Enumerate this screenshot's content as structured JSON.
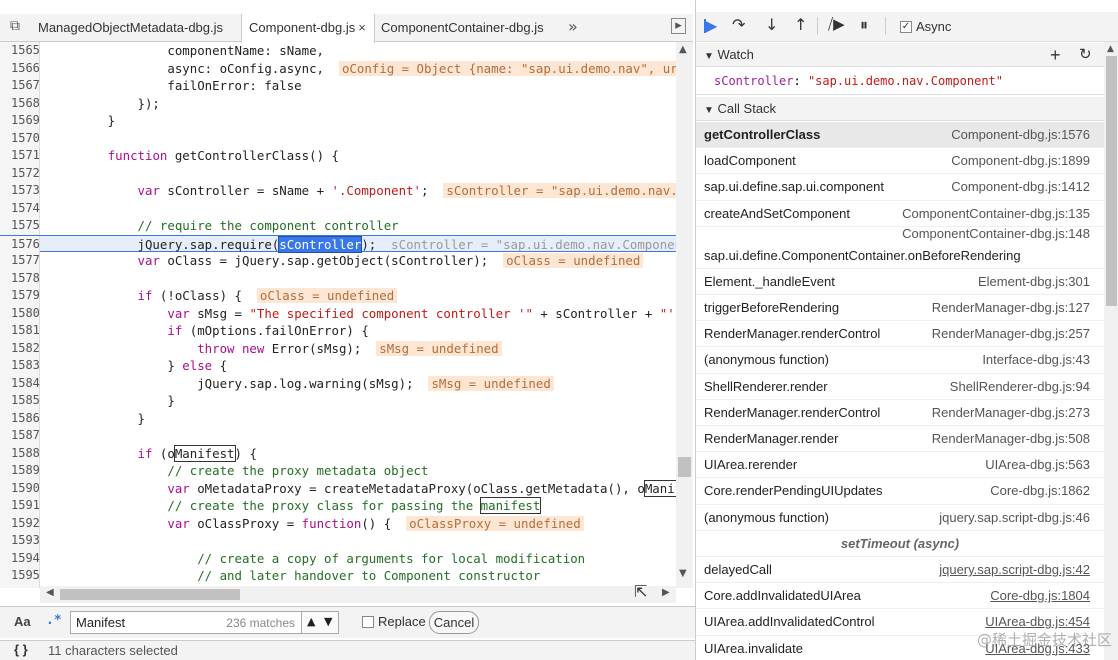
{
  "tabs": [
    {
      "label": "ManagedObjectMetadata-dbg.js",
      "active": false
    },
    {
      "label": "Component-dbg.js",
      "active": true
    },
    {
      "label": "ComponentContainer-dbg.js",
      "active": false
    }
  ],
  "code": {
    "lines": [
      {
        "n": "1565",
        "parts": [
          {
            "t": "                componentName: sName,"
          }
        ]
      },
      {
        "n": "1566",
        "parts": [
          {
            "t": "                async: oConfig.async,  "
          },
          {
            "t": "oConfig = Object {name: \"sap.ui.demo.nav\", url: \"\",",
            "c": "hv"
          }
        ]
      },
      {
        "n": "1567",
        "parts": [
          {
            "t": "                failOnError: false"
          }
        ]
      },
      {
        "n": "1568",
        "parts": [
          {
            "t": "            });"
          }
        ]
      },
      {
        "n": "1569",
        "parts": [
          {
            "t": "        }"
          }
        ]
      },
      {
        "n": "1570",
        "parts": [
          {
            "t": ""
          }
        ]
      },
      {
        "n": "1571",
        "parts": [
          {
            "t": "        "
          },
          {
            "t": "function",
            "c": "kw"
          },
          {
            "t": " getControllerClass() {"
          }
        ]
      },
      {
        "n": "1572",
        "parts": [
          {
            "t": ""
          }
        ]
      },
      {
        "n": "1573",
        "parts": [
          {
            "t": "            "
          },
          {
            "t": "var",
            "c": "kw"
          },
          {
            "t": " sController = sName + "
          },
          {
            "t": "'.Component'",
            "c": "str"
          },
          {
            "t": ";  "
          },
          {
            "t": "sController = \"sap.ui.demo.nav.Compon",
            "c": "hv"
          }
        ]
      },
      {
        "n": "1574",
        "parts": [
          {
            "t": ""
          }
        ]
      },
      {
        "n": "1575",
        "parts": [
          {
            "t": "            "
          },
          {
            "t": "// require the component controller",
            "c": "cm"
          }
        ]
      },
      {
        "n": "1576",
        "hl": true,
        "parts": [
          {
            "t": "            jQuery.sap.require("
          },
          {
            "t": "sController",
            "c": "sel"
          },
          {
            "t": ");  "
          },
          {
            "t": "sController = \"sap.ui.demo.nav.Component\"",
            "c": "hv2"
          }
        ]
      },
      {
        "n": "1577",
        "parts": [
          {
            "t": "            "
          },
          {
            "t": "var",
            "c": "kw"
          },
          {
            "t": " oClass = jQuery.sap.getObject(sController);  "
          },
          {
            "t": "oClass = undefined",
            "c": "hv"
          }
        ]
      },
      {
        "n": "1578",
        "parts": [
          {
            "t": ""
          }
        ]
      },
      {
        "n": "1579",
        "parts": [
          {
            "t": "            "
          },
          {
            "t": "if",
            "c": "kw"
          },
          {
            "t": " (!oClass) {  "
          },
          {
            "t": "oClass = undefined",
            "c": "hv"
          }
        ]
      },
      {
        "n": "1580",
        "parts": [
          {
            "t": "                "
          },
          {
            "t": "var",
            "c": "kw"
          },
          {
            "t": " sMsg = "
          },
          {
            "t": "\"The specified component controller '\"",
            "c": "str"
          },
          {
            "t": " + sController + "
          },
          {
            "t": "\"' could",
            "c": "str"
          }
        ]
      },
      {
        "n": "1581",
        "parts": [
          {
            "t": "                "
          },
          {
            "t": "if",
            "c": "kw"
          },
          {
            "t": " (mOptions.failOnError) {"
          }
        ]
      },
      {
        "n": "1582",
        "parts": [
          {
            "t": "                    "
          },
          {
            "t": "throw new",
            "c": "kw"
          },
          {
            "t": " Error(sMsg);  "
          },
          {
            "t": "sMsg = undefined",
            "c": "hv"
          }
        ]
      },
      {
        "n": "1583",
        "parts": [
          {
            "t": "                } "
          },
          {
            "t": "else",
            "c": "kw"
          },
          {
            "t": " {"
          }
        ]
      },
      {
        "n": "1584",
        "parts": [
          {
            "t": "                    jQuery.sap.log.warning(sMsg);  "
          },
          {
            "t": "sMsg = undefined",
            "c": "hv"
          }
        ]
      },
      {
        "n": "1585",
        "parts": [
          {
            "t": "                }"
          }
        ]
      },
      {
        "n": "1586",
        "parts": [
          {
            "t": "            }"
          }
        ]
      },
      {
        "n": "1587",
        "parts": [
          {
            "t": ""
          }
        ]
      },
      {
        "n": "1588",
        "parts": [
          {
            "t": "            "
          },
          {
            "t": "if",
            "c": "kw"
          },
          {
            "t": " (o"
          },
          {
            "t": "Manifest",
            "c": "box"
          },
          {
            "t": ") {"
          }
        ]
      },
      {
        "n": "1589",
        "parts": [
          {
            "t": "                "
          },
          {
            "t": "// create the proxy metadata object",
            "c": "cm"
          }
        ]
      },
      {
        "n": "1590",
        "parts": [
          {
            "t": "                "
          },
          {
            "t": "var",
            "c": "kw"
          },
          {
            "t": " oMetadataProxy = createMetadataProxy(oClass.getMetadata(), o"
          },
          {
            "t": "Manifest",
            "c": "box"
          },
          {
            "t": ");"
          }
        ]
      },
      {
        "n": "1591",
        "parts": [
          {
            "t": "                "
          },
          {
            "t": "// create the proxy class for passing the ",
            "c": "cm"
          },
          {
            "t": "manifest",
            "c": "box cm"
          }
        ]
      },
      {
        "n": "1592",
        "parts": [
          {
            "t": "                "
          },
          {
            "t": "var",
            "c": "kw"
          },
          {
            "t": " oClassProxy = "
          },
          {
            "t": "function",
            "c": "kw"
          },
          {
            "t": "() {  "
          },
          {
            "t": "oClassProxy = undefined",
            "c": "hv"
          }
        ]
      },
      {
        "n": "1593",
        "parts": [
          {
            "t": ""
          }
        ]
      },
      {
        "n": "1594",
        "parts": [
          {
            "t": "                    "
          },
          {
            "t": "// create a copy of arguments for local modification",
            "c": "cm"
          }
        ]
      },
      {
        "n": "1595",
        "parts": [
          {
            "t": "                    "
          },
          {
            "t": "// and later handover to Component constructor",
            "c": "cm"
          }
        ]
      },
      {
        "n": "1596",
        "parts": [
          {
            "t": ""
          }
        ]
      }
    ]
  },
  "search": {
    "case_label": "Aa",
    "regex_label": ".*",
    "value": "Manifest",
    "matches": "236 matches",
    "replace_label": "Replace",
    "cancel_label": "Cancel"
  },
  "status": {
    "braces": "{ }",
    "text": "11 characters selected"
  },
  "toolbar": {
    "async_label": "Async"
  },
  "watch": {
    "title": "Watch",
    "add": "+",
    "refresh": "↻",
    "expression": "sController",
    "value": "\"sap.ui.demo.nav.Component\""
  },
  "callstack": {
    "title": "Call Stack",
    "frames": [
      {
        "fn": "getControllerClass",
        "loc": "Component-dbg.js:1576",
        "sel": true
      },
      {
        "fn": "loadComponent",
        "loc": "Component-dbg.js:1899"
      },
      {
        "fn": "sap.ui.define.sap.ui.component",
        "loc": "Component-dbg.js:1412"
      },
      {
        "fn": "createAndSetComponent",
        "loc": "ComponentContainer-dbg.js:135"
      },
      {
        "fn": "sap.ui.define.ComponentContainer.onBeforeRendering",
        "loc": "ComponentContainer-dbg.js:148",
        "tall": true
      },
      {
        "fn": "Element._handleEvent",
        "loc": "Element-dbg.js:301"
      },
      {
        "fn": "triggerBeforeRendering",
        "loc": "RenderManager-dbg.js:127"
      },
      {
        "fn": "RenderManager.renderControl",
        "loc": "RenderManager-dbg.js:257"
      },
      {
        "fn": "(anonymous function)",
        "loc": "Interface-dbg.js:43"
      },
      {
        "fn": "ShellRenderer.render",
        "loc": "ShellRenderer-dbg.js:94"
      },
      {
        "fn": "RenderManager.renderControl",
        "loc": "RenderManager-dbg.js:273"
      },
      {
        "fn": "RenderManager.render",
        "loc": "RenderManager-dbg.js:508"
      },
      {
        "fn": "UIArea.rerender",
        "loc": "UIArea-dbg.js:563"
      },
      {
        "fn": "Core.renderPendingUIUpdates",
        "loc": "Core-dbg.js:1862"
      },
      {
        "fn": "(anonymous function)",
        "loc": "jquery.sap.script-dbg.js:46"
      },
      {
        "fn": "setTimeout (async)",
        "loc": "",
        "async": true
      },
      {
        "fn": "delayedCall",
        "loc": "jquery.sap.script-dbg.js:42",
        "u": true
      },
      {
        "fn": "Core.addInvalidatedUIArea",
        "loc": "Core-dbg.js:1804",
        "u": true
      },
      {
        "fn": "UIArea.addInvalidatedControl",
        "loc": "UIArea-dbg.js:454",
        "u": true
      },
      {
        "fn": "UIArea.invalidate",
        "loc": "UIArea-dbg.js:433",
        "u": true
      }
    ]
  },
  "watermark": "@稀土掘金技术社区"
}
